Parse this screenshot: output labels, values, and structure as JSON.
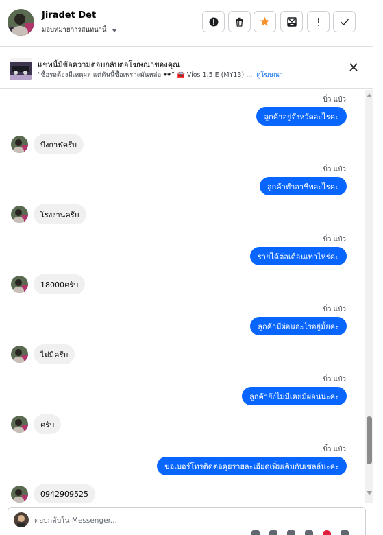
{
  "header": {
    "contact_name": "Jiradet Det",
    "assign_label": "มอบหมายการสนทนานี้",
    "actions": [
      {
        "name": "spam",
        "icon": "exclamation-circle-icon"
      },
      {
        "name": "delete",
        "icon": "trash-icon"
      },
      {
        "name": "star",
        "icon": "star-icon",
        "color": "#f5902a"
      },
      {
        "name": "archive",
        "icon": "archive-envelope-icon"
      },
      {
        "name": "mark-unread",
        "icon": "exclamation-icon"
      },
      {
        "name": "done",
        "icon": "checkmark-icon"
      }
    ]
  },
  "ad": {
    "title": "แชทนี้มีข้อความตอบกลับต่อโฆษณาของคุณ",
    "subtitle": "“ซื้อรถต้องมีเหตุผล แต่คันนี้ซื้อเพราะมันหล่อ 🕶️” 🚘 Vios 1.5 E (MY13) ...",
    "link_label": "ดูโฆษณา"
  },
  "messages": [
    {
      "dir": "out",
      "text": "ลูกค้าอยู่จังหวัดอะไรคะ",
      "seen": "บิ๋ว แป๋ว"
    },
    {
      "dir": "in",
      "text": "บึงกาฬครับ"
    },
    {
      "dir": "out",
      "text": "ลูกค้าทำอาชีพอะไรคะ",
      "seen": "บิ๋ว แป๋ว"
    },
    {
      "dir": "in",
      "text": "โรงงานครับ"
    },
    {
      "dir": "out",
      "text": "รายได้ต่อเดือนเท่าไหร่คะ",
      "seen": "บิ๋ว แป๋ว"
    },
    {
      "dir": "in",
      "text": "18000ครับ"
    },
    {
      "dir": "out",
      "text": "ลูกค้ามีผ่อนอะไรอยู่มั้ยคะ",
      "seen": "บิ๋ว แป๋ว"
    },
    {
      "dir": "in",
      "text": "ไม่มีครับ"
    },
    {
      "dir": "out",
      "text": "ลูกค้ายังไม่มีเคยมีผ่อนนะคะ",
      "seen": "บิ๋ว แป๋ว"
    },
    {
      "dir": "in",
      "text": "ครับ"
    },
    {
      "dir": "out",
      "text": "ขอเบอร์โทรติดต่อคุยรายละเอียดเพิ่มเติมกับเซลล์นะคะ",
      "seen": "บิ๋ว แป๋ว"
    },
    {
      "dir": "in",
      "text": "0942909525"
    }
  ],
  "composer": {
    "placeholder": "ตอบกลับใน Messenger..."
  },
  "colors": {
    "accent": "#0866ff",
    "incoming_bubble": "#f0f0f0",
    "star": "#f5902a"
  }
}
